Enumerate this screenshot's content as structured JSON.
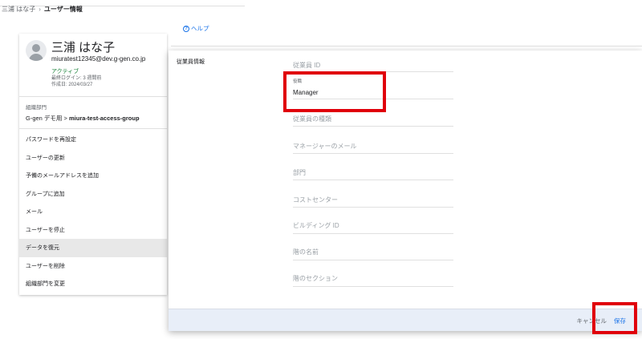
{
  "breadcrumb": {
    "parent": "三浦 はな子",
    "separator": "›",
    "current": "ユーザー情報"
  },
  "user": {
    "name": "三浦 はな子",
    "email": "miuratest12345@dev.g-gen.co.jp",
    "status": "アクティブ",
    "last_login": "最終ログイン: 3 週間前",
    "created": "作成日: 2024/03/27"
  },
  "org": {
    "label": "組織部門",
    "path_prefix": "G-gen デモ用 >",
    "path_current": "miura-test-access-group"
  },
  "actions": [
    "パスワードを再設定",
    "ユーザーの更新",
    "予備のメールアドレスを追加",
    "グループに追加",
    "メール",
    "ユーザーを停止",
    "データを復元",
    "ユーザーを削除",
    "組織部門を変更"
  ],
  "active_action_index": 6,
  "help": {
    "icon": "help-circle-icon",
    "label": "ヘルプ"
  },
  "modal": {
    "section_title": "従業員情報",
    "fields": {
      "employee_id": {
        "placeholder": "従業員 ID"
      },
      "title": {
        "label": "役職",
        "value": "Manager"
      },
      "employee_type": {
        "placeholder": "従業員の種類"
      },
      "manager_email": {
        "placeholder": "マネージャーのメール"
      },
      "department": {
        "placeholder": "部門"
      },
      "cost_center": {
        "placeholder": "コストセンター"
      },
      "building_id": {
        "placeholder": "ビルディング ID"
      },
      "floor_name": {
        "placeholder": "階の名前"
      },
      "floor_section": {
        "placeholder": "階のセクション"
      }
    },
    "cancel_label": "キャンセル",
    "save_label": "保存"
  },
  "colors": {
    "accent": "#1a73e8",
    "active_status": "#188038",
    "highlight": "#e0000a"
  }
}
